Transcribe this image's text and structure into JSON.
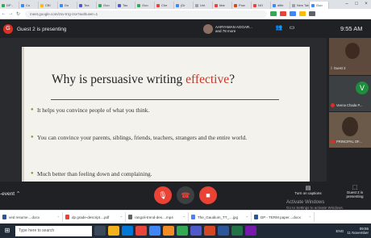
{
  "browser": {
    "tabs": [
      {
        "label": "DP -",
        "color": "#34a853"
      },
      {
        "label": "Co",
        "color": "#4285f4"
      },
      {
        "label": "CB!",
        "color": "#fbbc04"
      },
      {
        "label": "Do",
        "color": "#4285f4"
      },
      {
        "label": "Tea",
        "color": "#5059c9"
      },
      {
        "label": "Goo",
        "color": "#34a853"
      },
      {
        "label": "Tas",
        "color": "#5059c9"
      },
      {
        "label": "Goo",
        "color": "#34a853"
      },
      {
        "label": "Che",
        "color": "#ea4335"
      },
      {
        "label": "(Dr",
        "color": "#4285f4"
      },
      {
        "label": "Unt",
        "color": "#9aa0a6"
      },
      {
        "label": "Mar",
        "color": "#ea4335"
      },
      {
        "label": "Pow",
        "color": "#d24726"
      },
      {
        "label": "NO",
        "color": "#ea4335"
      },
      {
        "label": "diffe",
        "color": "#4285f4"
      },
      {
        "label": "New Tab",
        "color": "#9aa0a6"
      },
      {
        "label": "Goo",
        "color": "#4285f4"
      }
    ],
    "url": "meet.google.com/zsv-trrg-zsv?authuser=1"
  },
  "meet": {
    "presenter_initial": "G",
    "presenting_text": "Guest 2 is presenting",
    "participants_chip": {
      "line1": "AARYAMAN AGGAR...",
      "line2": "and 78 more"
    },
    "time": "9:55 AM",
    "slide": {
      "title_plain": "Why is persuasive writing ",
      "title_highlight": "effective",
      "title_end": "?",
      "bullets": [
        "It helps you convince people of what you think.",
        "You can convince your parents, siblings, friends, teachers, strangers and the entire world.",
        "Much better than feeling down and complaining."
      ]
    },
    "side_tiles": [
      {
        "name": "Guest 2"
      },
      {
        "name": "Veena Chada P...",
        "initial": "V"
      },
      {
        "name": "PRINCIPAL OF..."
      }
    ],
    "event_label": "-event",
    "captions_label": "Turn on captions",
    "present_label": "Guest 2 is presenting"
  },
  "watermark": {
    "title": "Activate Windows",
    "subtitle": "Go to Settings to activate Windows."
  },
  "downloads": [
    {
      "name": "ved resume....docx",
      "color": "#2b579a"
    },
    {
      "name": "dp grade-descript....pdf",
      "color": "#ea4335"
    },
    {
      "name": "rangoli-trend-des....mp4",
      "color": "#5f6368"
    },
    {
      "name": "The_Gaudium_TT_....jpg",
      "color": "#4285f4"
    },
    {
      "name": "DP - TERM paper....docx",
      "color": "#2b579a"
    }
  ],
  "taskbar": {
    "search_placeholder": "Type here to search",
    "apps": [
      "#3a4a5a",
      "#f2b21b",
      "#0078d7",
      "#e8453c",
      "#4285f4",
      "#f28b25",
      "#34a853",
      "#5059c9",
      "#d24726",
      "#2b579a",
      "#217346",
      "#7719aa"
    ],
    "language": "ENG",
    "time": "09:55",
    "date": "11 November"
  }
}
